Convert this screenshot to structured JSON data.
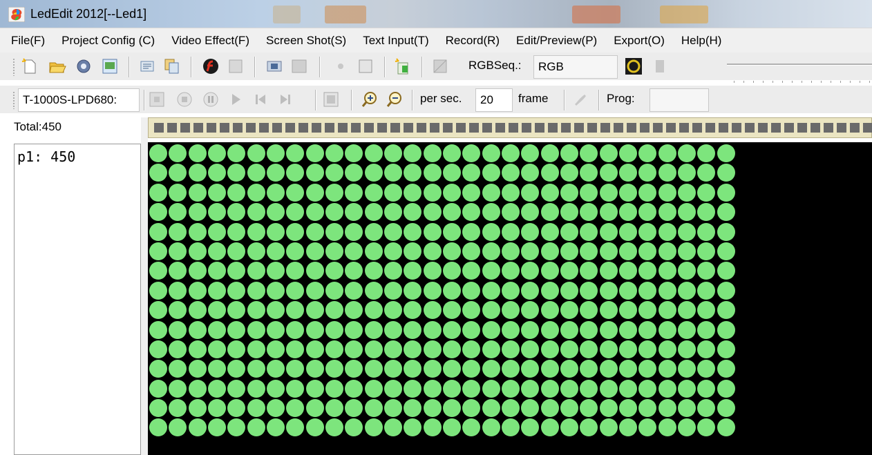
{
  "window": {
    "title": "LedEdit 2012[--Led1]",
    "app_icon": "app-logo-icon",
    "accent_green": "#7de57d",
    "canvas_background": "#000000"
  },
  "menu": {
    "items": [
      {
        "label": "File(F)",
        "name": "menu-file"
      },
      {
        "label": "Project Config (C)",
        "name": "menu-project-config"
      },
      {
        "label": "Video Effect(F)",
        "name": "menu-video-effect"
      },
      {
        "label": "Screen Shot(S)",
        "name": "menu-screen-shot"
      },
      {
        "label": "Text Input(T)",
        "name": "menu-text-input"
      },
      {
        "label": "Record(R)",
        "name": "menu-record"
      },
      {
        "label": "Edit/Preview(P)",
        "name": "menu-edit-preview"
      },
      {
        "label": "Export(O)",
        "name": "menu-export"
      },
      {
        "label": "Help(H)",
        "name": "menu-help"
      }
    ]
  },
  "toolbar1": {
    "icons": [
      "new-file-icon",
      "open-folder-icon",
      "settings-gear-icon",
      "image-icon",
      "text-icon",
      "copy-icon",
      "flash-icon",
      "disabled-square-icon",
      "screenshot-icon",
      "disabled-screen-icon",
      "disabled-record-icon",
      "frame-icon",
      "add-layer-icon",
      "disabled-export-icon"
    ],
    "rgb_seq_label": "RGBSeq.:",
    "rgb_seq_value": "RGB",
    "extra_icons": [
      "ring-icon",
      "disabled-page-icon"
    ]
  },
  "toolbar2": {
    "controller_value": "T-1000S-LPD680:",
    "playback_icons": [
      "disabled-stop-icon",
      "stop-icon",
      "pause-icon",
      "play-icon",
      "first-frame-icon",
      "last-frame-icon",
      "square-icon",
      "zoom-in-icon",
      "zoom-out-icon"
    ],
    "per_sec_label": "per sec.",
    "per_sec_value": "20",
    "frame_label": "frame",
    "frame_icon": "disabled-brush-icon",
    "prog_label": "Prog:",
    "prog_value": ""
  },
  "left_panel": {
    "total_label": "Total:450",
    "programs": [
      {
        "label": "p1:",
        "count": "450"
      }
    ]
  },
  "led_display": {
    "columns": 30,
    "rows": 15,
    "led_count": 450
  }
}
